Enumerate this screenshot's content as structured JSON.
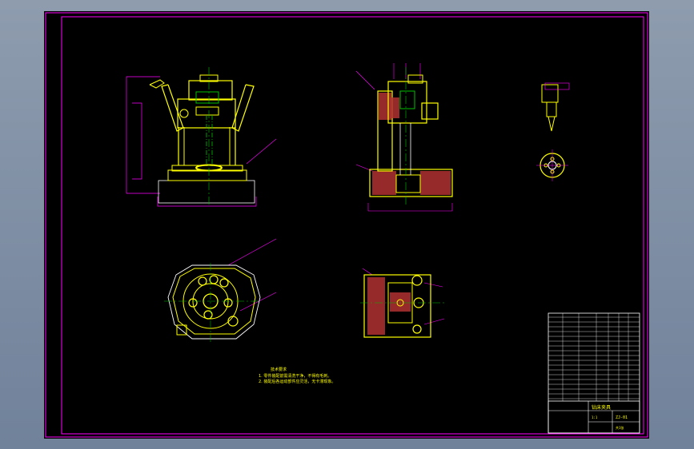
{
  "drawing": {
    "notes_heading": "技术要求",
    "notes_lines": [
      "1. 零件装配前需清洗干净，不得有毛刺。",
      "2. 装配后各运动部件应灵活，无卡滞现象。"
    ],
    "title_block": {
      "drawing_name": "钻床夹具",
      "drawing_no": "ZJ-01",
      "scale": "1:1",
      "sheet": "共1张"
    }
  },
  "colors": {
    "frame": "#ff00ff",
    "outline": "#ffff00",
    "centerline": "#00c000",
    "section": "#ff3030",
    "background": "#000000"
  }
}
